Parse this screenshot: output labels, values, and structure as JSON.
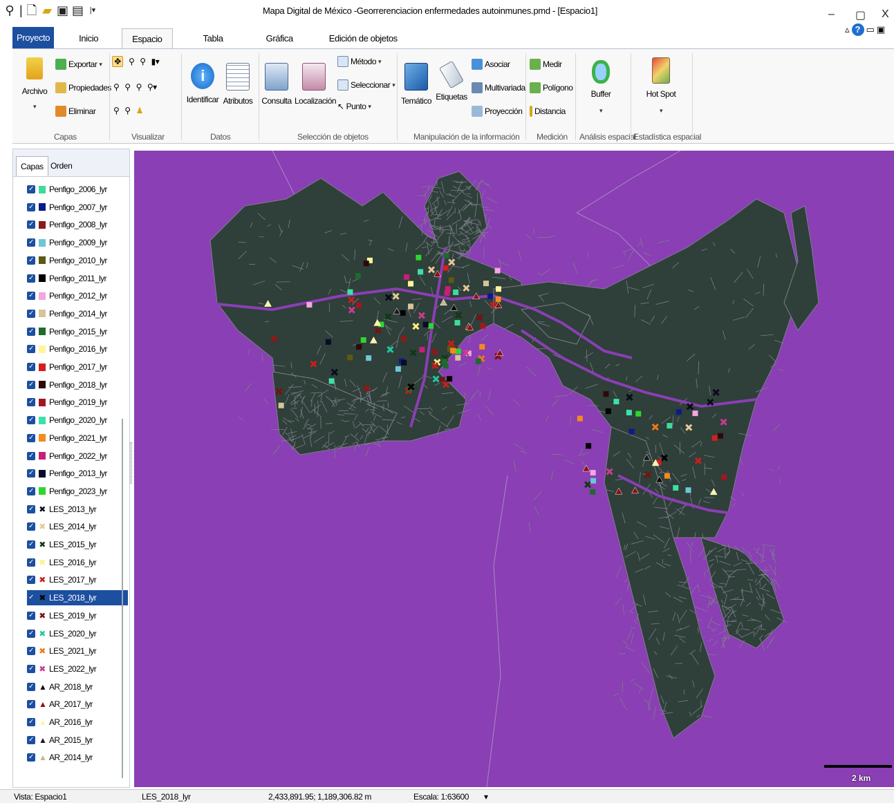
{
  "window": {
    "title": "Mapa Digital de México -Georrerenciacion enfermedades autoinmunes.pmd - [Espacio1]",
    "minimize": "–",
    "restore": "▢",
    "close": "X"
  },
  "quick_access": [
    "map-pin-icon",
    "new-icon",
    "open-folder-icon",
    "save-icon",
    "table-icon"
  ],
  "ribbon": {
    "file_tab": "Proyecto",
    "tabs": [
      "Inicio",
      "Espacio",
      "Tabla",
      "Gráfica",
      "Edición de objetos"
    ],
    "active_tab": "Espacio",
    "groups": {
      "capas": {
        "label": "Capas",
        "archivo": "Archivo",
        "exportar": "Exportar",
        "propiedades": "Propiedades",
        "eliminar": "Eliminar"
      },
      "visualizar": {
        "label": "Visualizar"
      },
      "datos": {
        "label": "Datos",
        "identificar": "Identificar",
        "atributos": "Atributos"
      },
      "seleccion": {
        "label": "Selección de objetos",
        "consulta": "Consulta",
        "localizacion": "Localización",
        "metodo": "Método",
        "seleccionar": "Seleccionar",
        "punto": "Punto"
      },
      "manipulacion": {
        "label": "Manipulación de la información",
        "tematico": "Temático",
        "etiquetas": "Etiquetas",
        "asociar": "Asociar",
        "multivariada": "Multivariada",
        "proyeccion": "Proyección"
      },
      "medicion": {
        "label": "Medición",
        "medir": "Medir",
        "poligono": "Polígono",
        "distancia": "Distancia"
      },
      "analisis": {
        "label": "Análisis espacial",
        "buffer": "Buffer"
      },
      "estadistica": {
        "label": "Estadística espacial",
        "hotspot": "Hot Spot"
      }
    }
  },
  "panel": {
    "tabs": [
      "Capas",
      "Orden"
    ],
    "active_tab": "Capas",
    "layers": [
      {
        "name": "Penfigo_2006_lyr",
        "symbol": "square",
        "color": "#3ddc9a"
      },
      {
        "name": "Penfigo_2007_lyr",
        "symbol": "square",
        "color": "#0b1a8c"
      },
      {
        "name": "Penfigo_2008_lyr",
        "symbol": "square",
        "color": "#8b1a1a"
      },
      {
        "name": "Penfigo_2009_lyr",
        "symbol": "square",
        "color": "#6ec6d6"
      },
      {
        "name": "Penfigo_2010_lyr",
        "symbol": "square",
        "color": "#5c5a12"
      },
      {
        "name": "Penfigo_2011_lyr",
        "symbol": "square",
        "color": "#000000"
      },
      {
        "name": "Penfigo_2012_lyr",
        "symbol": "square",
        "color": "#f4a6e0"
      },
      {
        "name": "Penfigo_2014_lyr",
        "symbol": "square",
        "color": "#d6c49a"
      },
      {
        "name": "Penfigo_2015_lyr",
        "symbol": "square",
        "color": "#1e6b2c"
      },
      {
        "name": "Penfigo_2016_lyr",
        "symbol": "square",
        "color": "#fff59a"
      },
      {
        "name": "Penfigo_2017_lyr",
        "symbol": "square",
        "color": "#d41e1e"
      },
      {
        "name": "Penfigo_2018_lyr",
        "symbol": "square",
        "color": "#2a0a0a"
      },
      {
        "name": "Penfigo_2019_lyr",
        "symbol": "square",
        "color": "#a01820"
      },
      {
        "name": "Penfigo_2020_lyr",
        "symbol": "square",
        "color": "#3de0a6"
      },
      {
        "name": "Penfigo_2021_lyr",
        "symbol": "square",
        "color": "#f28c1e"
      },
      {
        "name": "Penfigo_2022_lyr",
        "symbol": "square",
        "color": "#c81e78"
      },
      {
        "name": "Penfigo_2013_lyr",
        "symbol": "square",
        "color": "#0a0a2a"
      },
      {
        "name": "Penfigo_2023_lyr",
        "symbol": "square",
        "color": "#2ed62e"
      },
      {
        "name": "LES_2013_lyr",
        "symbol": "cross",
        "color": "#0a0a1a"
      },
      {
        "name": "LES_2014_lyr",
        "symbol": "cross",
        "color": "#e6c896"
      },
      {
        "name": "LES_2015_lyr",
        "symbol": "cross",
        "color": "#0f3a14"
      },
      {
        "name": "LES_2016_lyr",
        "symbol": "cross",
        "color": "#fff080"
      },
      {
        "name": "LES_2017_lyr",
        "symbol": "cross",
        "color": "#c81e1e"
      },
      {
        "name": "LES_2018_lyr",
        "symbol": "cross",
        "color": "#000000",
        "selected": true
      },
      {
        "name": "LES_2019_lyr",
        "symbol": "cross",
        "color": "#7a1010"
      },
      {
        "name": "LES_2020_lyr",
        "symbol": "cross",
        "color": "#1ec8a0"
      },
      {
        "name": "LES_2021_lyr",
        "symbol": "cross",
        "color": "#f07818"
      },
      {
        "name": "LES_2022_lyr",
        "symbol": "cross",
        "color": "#c83c8c"
      },
      {
        "name": "AR_2018_lyr",
        "symbol": "triangle",
        "color": "#0a0a0a"
      },
      {
        "name": "AR_2017_lyr",
        "symbol": "triangle",
        "color": "#8b1010"
      },
      {
        "name": "AR_2016_lyr",
        "symbol": "triangle",
        "color": "#fff59a"
      },
      {
        "name": "AR_2015_lyr",
        "symbol": "triangle",
        "color": "#1a1a1a"
      },
      {
        "name": "AR_2014_lyr",
        "symbol": "triangle",
        "color": "#c8b490"
      }
    ]
  },
  "map": {
    "background_color": "#8a3fb4",
    "urban_color": "#2f3f3a",
    "street_color": "#7d7f8a",
    "scale_label": "2 km"
  },
  "status": {
    "vista": "Vista: Espacio1",
    "layer": "LES_2018_lyr",
    "coords": "2,433,891.95; 1,189,306.82 m",
    "escala": "Escala: 1:63600",
    "caret": "▾"
  }
}
